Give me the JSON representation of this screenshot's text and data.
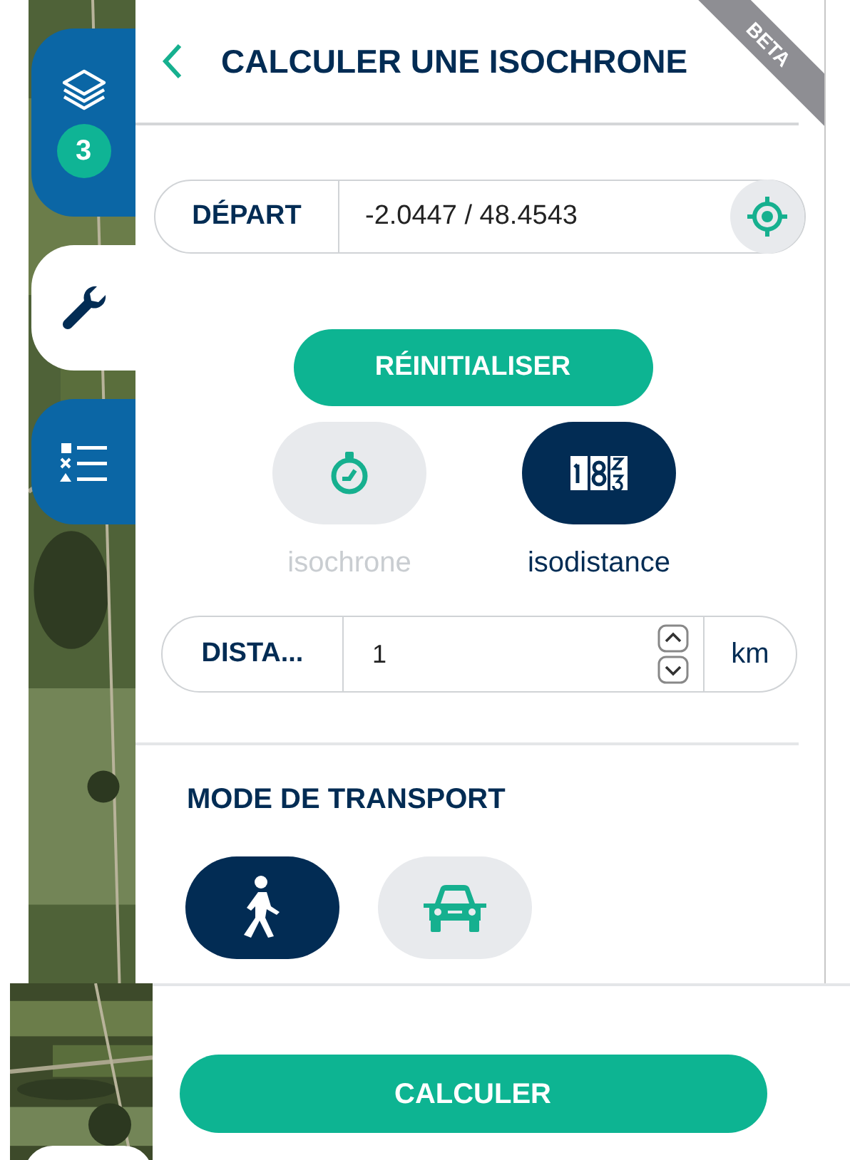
{
  "side_tabs": [
    {
      "kind": "layers",
      "selected": false,
      "badge": "3"
    },
    {
      "kind": "tools",
      "selected": true
    },
    {
      "kind": "legend",
      "selected": false
    }
  ],
  "panel": {
    "title": "CALCULER UNE ISOCHRONE",
    "ribbon": "BETA",
    "start": {
      "label": "DÉPART",
      "value": "-2.0447 / 48.4543"
    },
    "reset_button": "RÉINITIALISER",
    "modes": [
      {
        "kind": "isochrone",
        "label": "isochrone",
        "selected": false
      },
      {
        "kind": "isodistance",
        "label": "isodistance",
        "selected": true
      }
    ],
    "distance": {
      "label": "DISTA...",
      "value": "1",
      "unit": "km"
    },
    "transport_title": "MODE DE TRANSPORT",
    "transport": [
      {
        "kind": "walk",
        "selected": true
      },
      {
        "kind": "car",
        "selected": false
      }
    ]
  },
  "submit_button": "CALCULER"
}
